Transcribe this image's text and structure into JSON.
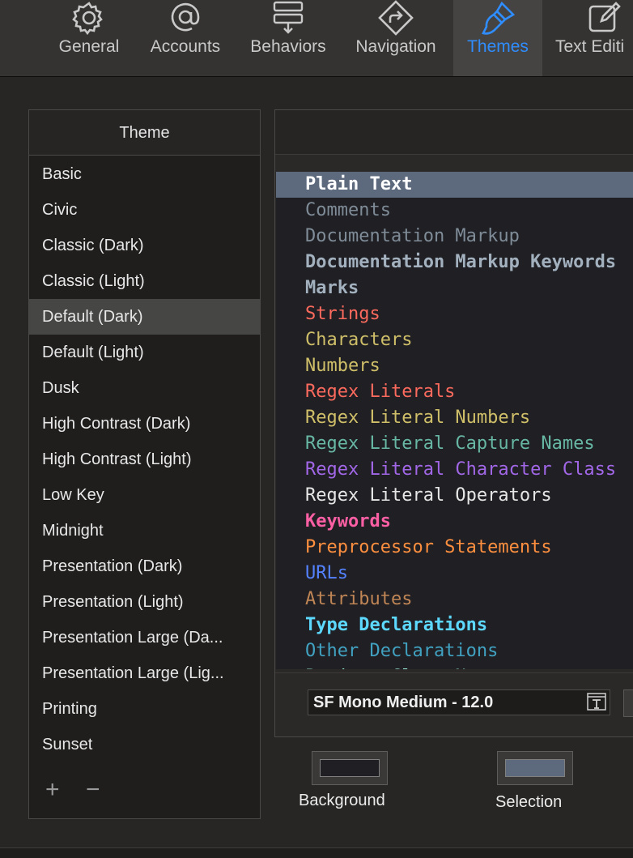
{
  "toolbar": {
    "items": [
      {
        "label": "General",
        "icon": "gear-icon"
      },
      {
        "label": "Accounts",
        "icon": "at-icon"
      },
      {
        "label": "Behaviors",
        "icon": "behaviors-icon"
      },
      {
        "label": "Navigation",
        "icon": "navigation-icon"
      },
      {
        "label": "Themes",
        "icon": "paintbrush-icon",
        "active": true
      },
      {
        "label": "Text Editi",
        "icon": "edit-icon"
      }
    ],
    "accent_color": "#2f8dff"
  },
  "theme_list": {
    "header": "Theme",
    "items": [
      "Basic",
      "Civic",
      "Classic (Dark)",
      "Classic (Light)",
      "Default (Dark)",
      "Default (Light)",
      "Dusk",
      "High Contrast (Dark)",
      "High Contrast (Light)",
      "Low Key",
      "Midnight",
      "Presentation (Dark)",
      "Presentation (Light)",
      "Presentation Large (Da...",
      "Presentation Large (Lig...",
      "Printing",
      "Sunset"
    ],
    "selected_index": 4,
    "add_label": "+",
    "remove_label": "−"
  },
  "syntax": {
    "lines": [
      {
        "text": "Plain Text",
        "color": "#ffffff",
        "bold": true,
        "selected": true
      },
      {
        "text": "Comments",
        "color": "#7f8c98",
        "bold": false
      },
      {
        "text": "Documentation Markup",
        "color": "#7f8c98",
        "bold": false
      },
      {
        "text": "Documentation Markup Keywords",
        "color": "#a3b1bf",
        "bold": true
      },
      {
        "text": "Marks",
        "color": "#a3b1bf",
        "bold": true
      },
      {
        "text": "Strings",
        "color": "#fc6a5d",
        "bold": false
      },
      {
        "text": "Characters",
        "color": "#d0bf69",
        "bold": false
      },
      {
        "text": "Numbers",
        "color": "#d0bf69",
        "bold": false
      },
      {
        "text": "Regex Literals",
        "color": "#fc6a5d",
        "bold": false
      },
      {
        "text": "Regex Literal Numbers",
        "color": "#d0bf69",
        "bold": false
      },
      {
        "text": "Regex Literal Capture Names",
        "color": "#67b7a4",
        "bold": false
      },
      {
        "text": "Regex Literal Character Class",
        "color": "#a167e6",
        "bold": false
      },
      {
        "text": "Regex Literal Operators",
        "color": "#e6e6e6",
        "bold": false
      },
      {
        "text": "Keywords",
        "color": "#fc5fa3",
        "bold": true
      },
      {
        "text": "Preprocessor Statements",
        "color": "#fd8f3f",
        "bold": false
      },
      {
        "text": "URLs",
        "color": "#5482ff",
        "bold": false
      },
      {
        "text": "Attributes",
        "color": "#bf8555",
        "bold": false
      },
      {
        "text": "Type Declarations",
        "color": "#5dd8ff",
        "bold": true
      },
      {
        "text": "Other Declarations",
        "color": "#41a1c0",
        "bold": false
      },
      {
        "text": "Project Class Names",
        "color": "#9ef1dd",
        "bold": false
      }
    ],
    "font_value": "SF Mono Medium - 12.0",
    "font_icon": "text-font-icon"
  },
  "swatches": {
    "background_label": "Background",
    "background_color": "#1f1f24",
    "selection_label": "Selection",
    "selection_color": "#5d6a7e"
  }
}
